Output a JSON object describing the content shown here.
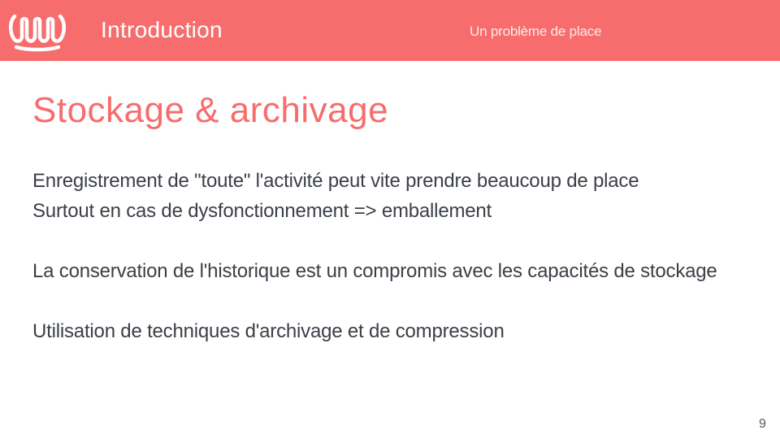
{
  "header": {
    "section_title": "Introduction",
    "subsection": "Un problème de place",
    "logo_icon": "wave-logo-icon",
    "background_color": "#f76d6d"
  },
  "slide": {
    "title": "Stockage & archivage",
    "title_color": "#f76d6d",
    "paragraphs": [
      {
        "line1": "Enregistrement de \"toute\" l'activité peut vite prendre beaucoup de place",
        "line2": "Surtout en cas de dysfonctionnement => emballement"
      },
      {
        "line1": "La conservation de l'historique est un compromis avec les capacités de stockage"
      },
      {
        "line1": "Utilisation de techniques d'archivage et de compression"
      }
    ]
  },
  "footer": {
    "page_number": "9"
  }
}
